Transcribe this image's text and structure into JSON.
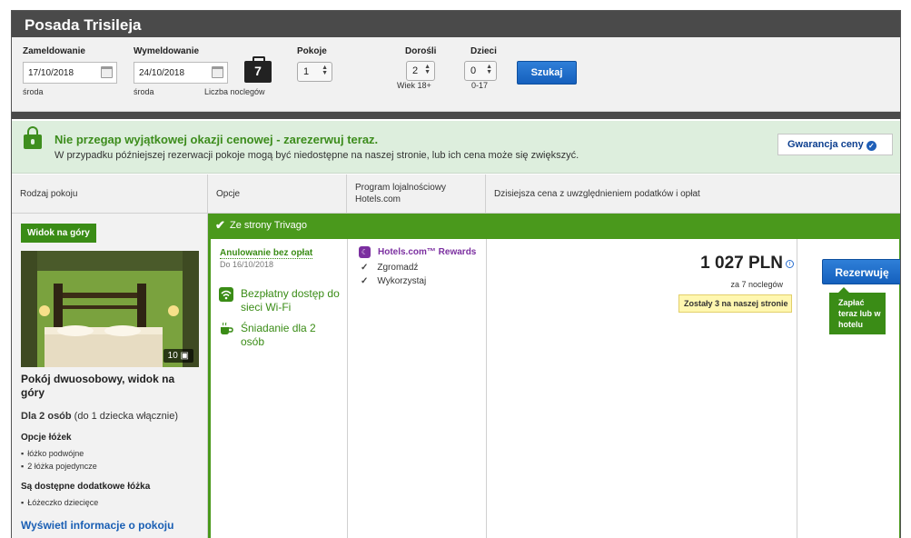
{
  "hotel": {
    "name": "Posada Trisileja"
  },
  "search": {
    "checkin_label": "Zameldowanie",
    "checkin_value": "17/10/2018",
    "checkin_day": "środa",
    "checkout_label": "Wymeldowanie",
    "checkout_value": "24/10/2018",
    "checkout_day": "środa",
    "nights_value": "7",
    "nights_label": "Liczba noclegów",
    "rooms_label": "Pokoje",
    "rooms_value": "1",
    "adults_label": "Dorośli",
    "adults_value": "2",
    "adults_sub": "Wiek 18+",
    "children_label": "Dzieci",
    "children_value": "0",
    "children_sub": "0-17",
    "search_button": "Szukaj"
  },
  "promo": {
    "title": "Nie przegap wyjątkowej okazji cenowej - zarezerwuj teraz.",
    "subtitle": "W przypadku późniejszej rezerwacji pokoje mogą być niedostępne na naszej stronie, lub ich cena może się zwiększyć.",
    "guarantee_label": "Gwarancja ceny"
  },
  "table": {
    "col_room_type": "Rodzaj pokoju",
    "col_options": "Opcje",
    "col_loyalty_1": "Program lojalnościowy",
    "col_loyalty_2": "Hotels.com",
    "col_price": "Dzisiejsza cena z uwzględnieniem podatków i opłat"
  },
  "room": {
    "badge": "Widok na góry",
    "photo_count": "10",
    "name": "Pokój dwuosobowy, widok na góry",
    "occupancy_bold": "Dla 2 osób",
    "occupancy_rest": " (do 1 dziecka włącznie)",
    "beds_title": "Opcje łóżek",
    "beds": [
      "łóżko podwójne",
      "2 łóżka pojedyncze"
    ],
    "extra_title": "Są dostępne dodatkowe łóżka",
    "extra": [
      "Łóżeczko dziecięce"
    ],
    "info_link": "Wyświetl informacje o pokoju"
  },
  "offer": {
    "source": "Ze strony Trivago",
    "cancel_label": "Anulowanie bez opłat",
    "cancel_date": "Do 16/10/2018",
    "wifi": "Bezpłatny dostęp do sieci Wi-Fi",
    "breakfast": "Śniadanie dla 2 osób",
    "rewards_title": "Hotels.com™ Rewards",
    "rewards_items": [
      "Zgromadź",
      "Wykorzystaj"
    ],
    "price": "1 027 PLN",
    "price_note": "za 7 noclegów",
    "availability": "Zostały 3 na naszej stronie",
    "book_button": "Rezerwuję",
    "pay_tip": "Zapłać teraz lub w hotelu"
  }
}
